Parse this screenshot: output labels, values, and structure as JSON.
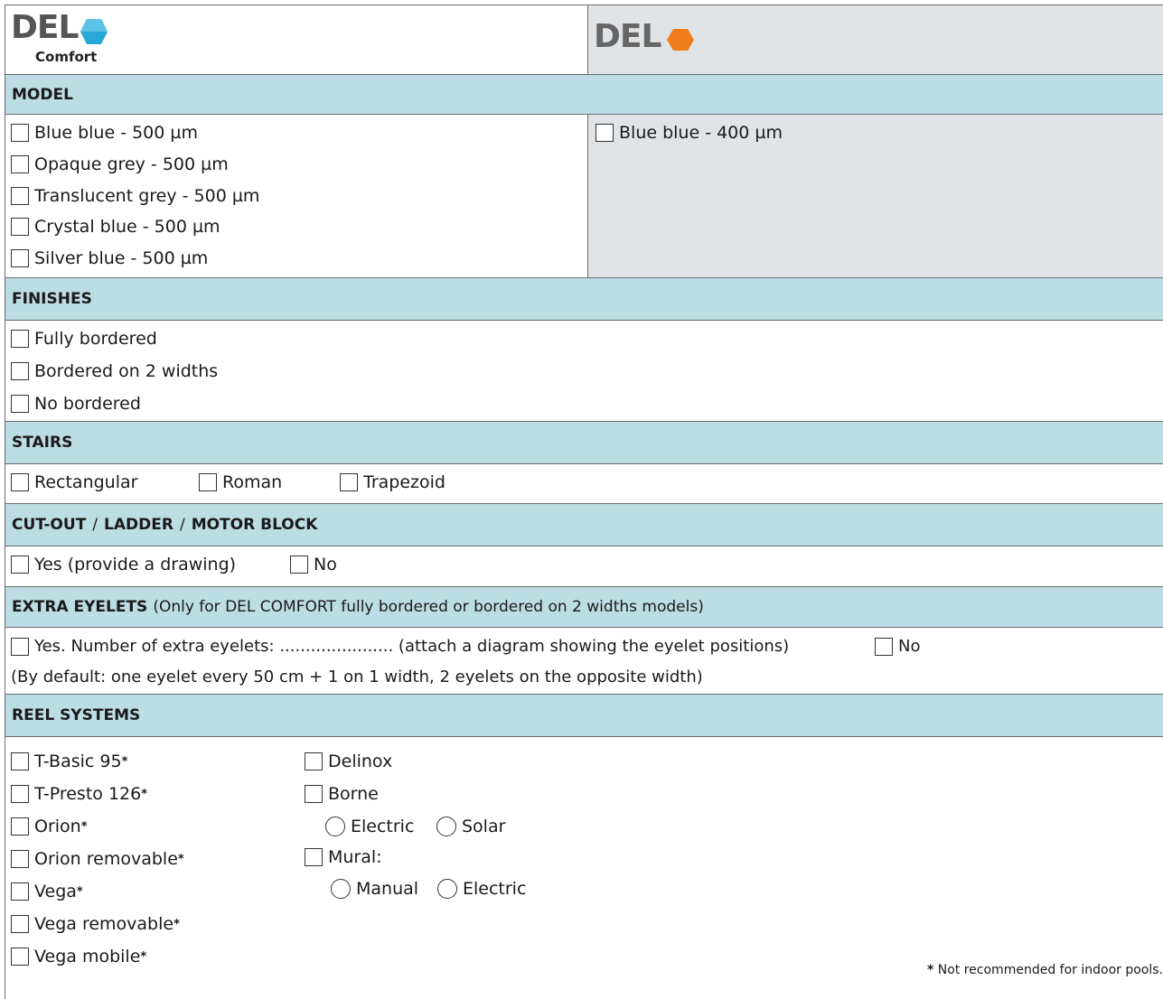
{
  "header": {
    "left_logo": {
      "brand": "DEL",
      "sub": "Comfort",
      "icon": "hexagon-icon",
      "color": "#1a9dcf"
    },
    "right_logo": {
      "brand": "DEL",
      "icon": "hexagon-icon",
      "color": "#f07d1c"
    }
  },
  "model": {
    "title": "MODEL",
    "left_options": [
      "Blue blue - 500 µm",
      "Opaque grey - 500 µm",
      "Translucent grey - 500 µm",
      "Crystal blue - 500 µm",
      "Silver blue - 500 µm"
    ],
    "right_options": [
      "Blue blue - 400 µm"
    ]
  },
  "finishes": {
    "title": "FINISHES",
    "options": [
      "Fully bordered",
      "Bordered on 2 widths",
      "No bordered"
    ]
  },
  "stairs": {
    "title": "STAIRS",
    "options": [
      "Rectangular",
      "Roman",
      "Trapezoid"
    ]
  },
  "cutout": {
    "title_parts": [
      "CUT-OUT",
      "/",
      "LADDER",
      "/",
      "MOTOR BLOCK"
    ],
    "options": [
      "Yes (provide a drawing)",
      "No"
    ]
  },
  "eyelets": {
    "title": "EXTRA EYELETS",
    "note": "(Only for DEL COMFORT fully bordered or bordered on 2 widths models)",
    "yes_label": "Yes. Number of extra eyelets: ...................... (attach a diagram showing the eyelet positions)",
    "no_label": "No",
    "default_note": "(By default: one eyelet every 50 cm + 1 on 1 width, 2 eyelets on the opposite width)"
  },
  "reels": {
    "title": "REEL SYSTEMS",
    "left_options": [
      "T-Basic 95",
      "T-Presto 126",
      "Orion",
      "Orion removable",
      "Vega",
      "Vega removable",
      "Vega mobile"
    ],
    "star": "*",
    "delinox": "Delinox",
    "borne": "Borne",
    "borne_sub": [
      "Electric",
      "Solar"
    ],
    "mural": "Mural:",
    "mural_sub": [
      "Manual",
      "Electric"
    ],
    "footnote_star": "*",
    "footnote": "Not recommended for indoor pools."
  },
  "colors": {
    "section_bg": "#bcdde3",
    "grey_panel": "#e1e4e7",
    "border": "#6b6b6b"
  }
}
